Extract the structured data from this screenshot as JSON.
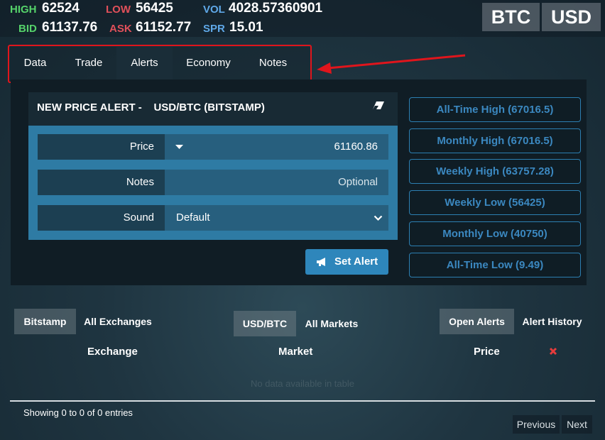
{
  "ticker": {
    "high_label": "HIGH",
    "high_value": "62524",
    "low_label": "LOW",
    "low_value": "56425",
    "vol_label": "VOL",
    "vol_value": "4028.57360901",
    "bid_label": "BID",
    "bid_value": "61137.76",
    "ask_label": "ASK",
    "ask_value": "61152.77",
    "spr_label": "SPR",
    "spr_value": "15.01",
    "base": "BTC",
    "quote": "USD"
  },
  "tabs": [
    {
      "label": "Data"
    },
    {
      "label": "Trade"
    },
    {
      "label": "Alerts",
      "active": true
    },
    {
      "label": "Economy"
    },
    {
      "label": "Notes"
    }
  ],
  "alert": {
    "title": "NEW PRICE ALERT -    USD/BTC (BITSTAMP)",
    "price_label": "Price",
    "price_value": "61160.86",
    "notes_label": "Notes",
    "notes_placeholder": "Optional",
    "sound_label": "Sound",
    "sound_value": "Default",
    "set_button": "Set Alert"
  },
  "presets": [
    "All-Time High (67016.5)",
    "Monthly High (67016.5)",
    "Weekly High (63757.28)",
    "Weekly Low (56425)",
    "Monthly Low (40750)",
    "All-Time Low (9.49)"
  ],
  "filters": {
    "exchange_selected": "Bitstamp",
    "exchange_all": "All Exchanges",
    "market_selected": "USD/BTC",
    "market_all": "All Markets",
    "open_alerts": "Open Alerts",
    "alert_history": "Alert History"
  },
  "table": {
    "columns": [
      "Exchange",
      "Market",
      "Price"
    ],
    "empty": "No data available in table",
    "showing": "Showing 0 to 0 of 0 entries",
    "previous": "Previous",
    "next": "Next"
  },
  "colors": {
    "accent": "#2e86bb",
    "high": "#55d26a",
    "low": "#e0505a",
    "vol": "#5fa8e8",
    "annotation": "#e0151c",
    "delete": "#e63c3c"
  }
}
